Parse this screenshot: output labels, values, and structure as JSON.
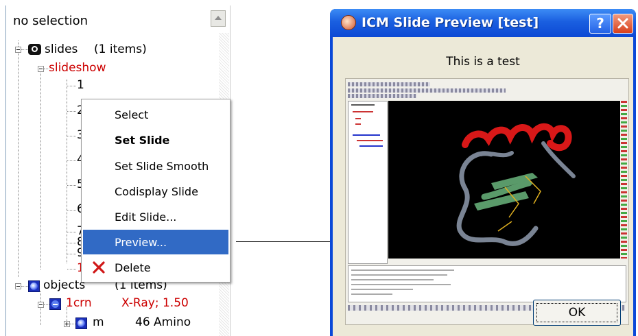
{
  "tree": {
    "header": "no selection",
    "nodes": {
      "slides_label": "slides",
      "slides_count": "(1 items)",
      "slideshow": "slideshow",
      "slide_numbers": [
        "1",
        "2",
        "3",
        "4",
        "5",
        "6",
        "7",
        "8",
        "9",
        "1"
      ],
      "objects_label": "objects",
      "objects_count": "(1 items)",
      "crn_label": "1crn",
      "crn_info": "X-Ray; 1.50",
      "m_label": "m",
      "m_info": "46 Amino"
    }
  },
  "context_menu": {
    "items": [
      "Select",
      "Set Slide",
      "Set Slide Smooth",
      "Codisplay Slide",
      "Edit Slide...",
      "Preview...",
      "Delete"
    ],
    "bold_item": "Set Slide",
    "selected_item": "Preview...",
    "delete_icon": "delete-x-icon"
  },
  "dialog": {
    "title": "ICM Slide Preview [test]",
    "caption": "This is a test",
    "help_label": "?",
    "ok_label": "OK"
  },
  "colors": {
    "tree_red": "#cc0000",
    "menu_highlight": "#316ac5",
    "titlebar_blue": "#0c49d4",
    "dialog_bg": "#ece9d8"
  }
}
